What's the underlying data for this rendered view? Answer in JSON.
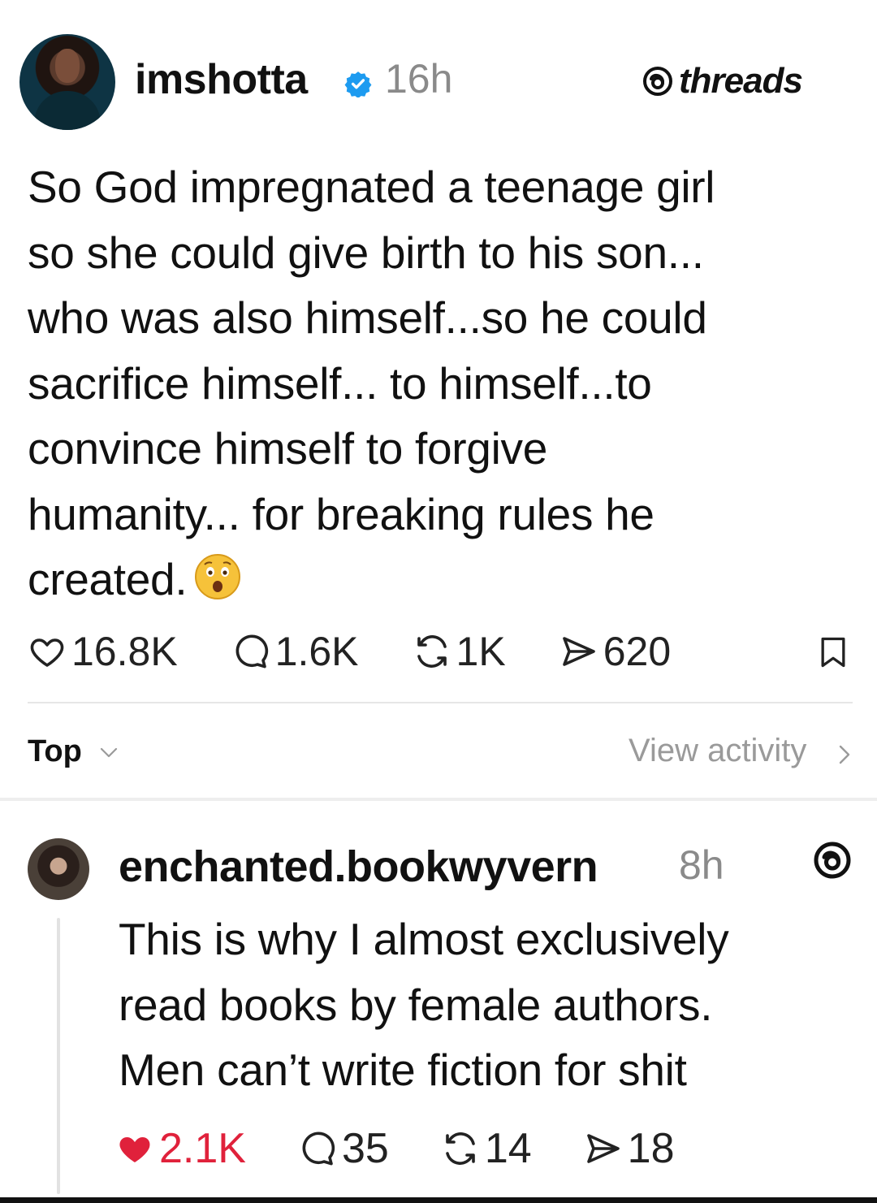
{
  "post": {
    "username": "imshotta",
    "time": "16h",
    "brand": "threads",
    "text": "So God impregnated a teenage girl\nso she could give birth to his son...\nwho was also himself...so he could\nsacrifice himself... to himself...to\nconvince himself to forgive\nhumanity... for breaking rules he\ncreated.",
    "emoji": "astonished-face",
    "stats": {
      "likes": "16.8K",
      "replies": "1.6K",
      "reposts": "1K",
      "shares": "620"
    }
  },
  "filter": {
    "sort_label": "Top",
    "view_activity_label": "View activity"
  },
  "reply": {
    "username": "enchanted.bookwyvern",
    "time": "8h",
    "text": "This is why I almost exclusively\nread books by female authors.\nMen can’t write fiction for shit",
    "stats": {
      "likes": "2.1K",
      "replies": "35",
      "reposts": "14",
      "shares": "18"
    }
  },
  "colors": {
    "verified": "#1d9bf0",
    "like_active": "#e0213b",
    "muted_text": "#8a8a8a"
  }
}
